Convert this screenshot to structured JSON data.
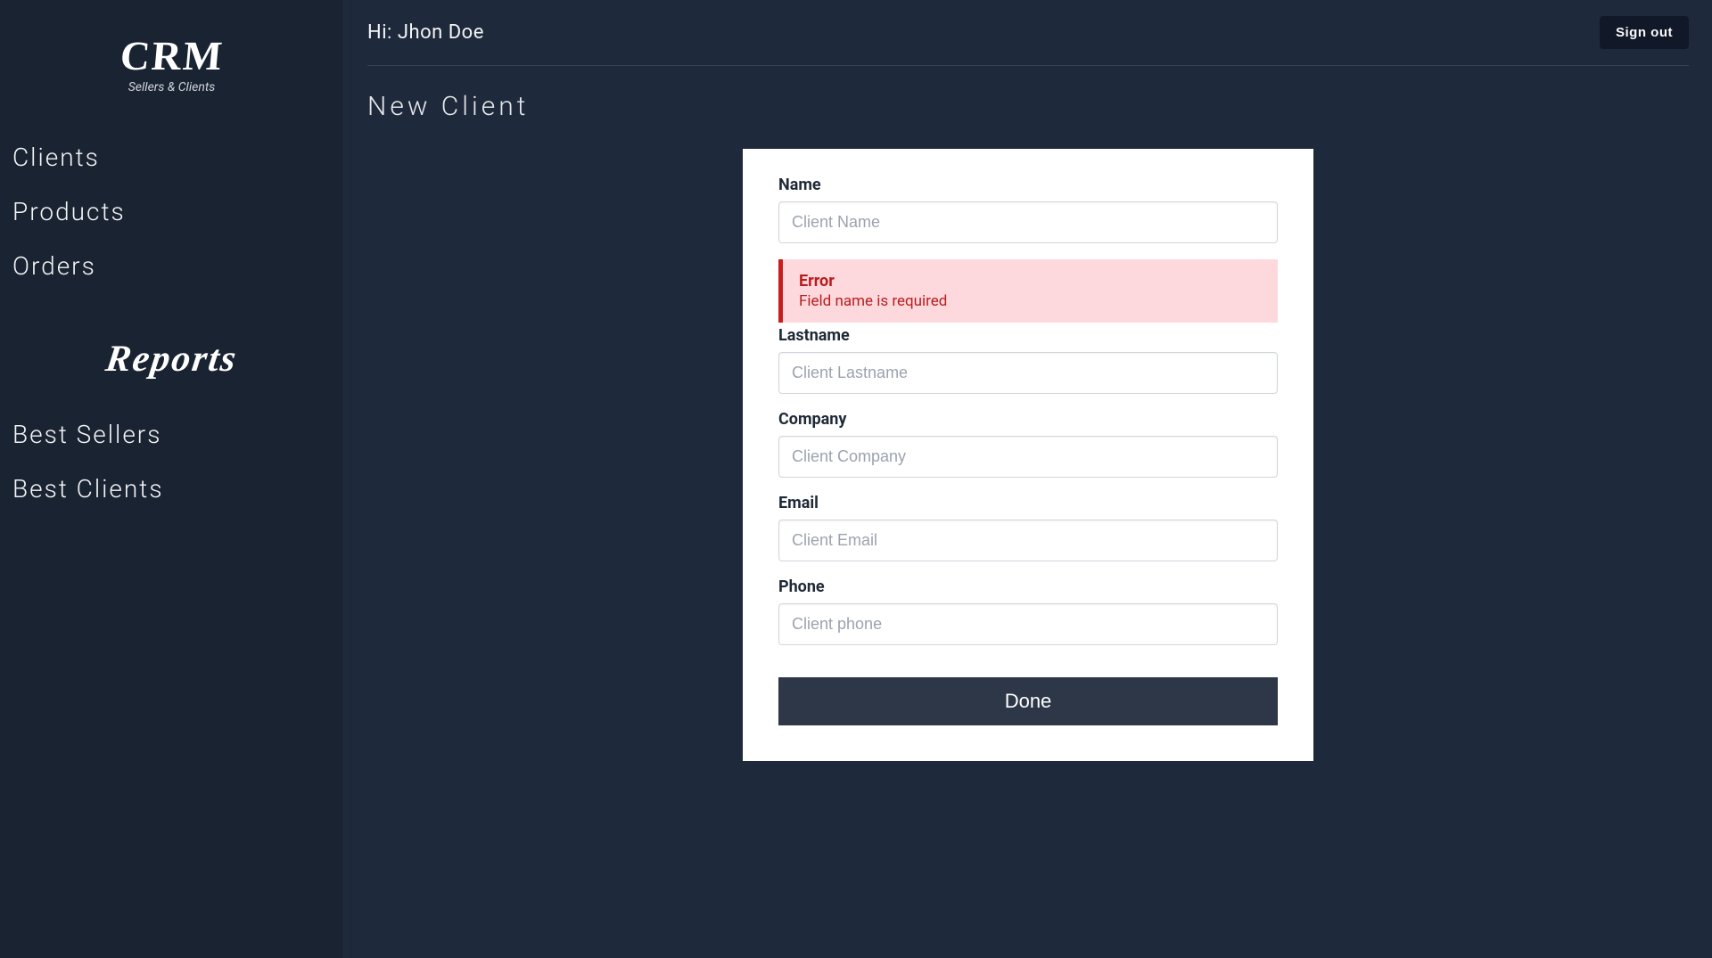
{
  "sidebar": {
    "logo_title": "CRM",
    "logo_sub": "Sellers & Clients",
    "nav": [
      {
        "label": "Clients"
      },
      {
        "label": "Products"
      },
      {
        "label": "Orders"
      }
    ],
    "reports_header": "Reports",
    "reports_nav": [
      {
        "label": "Best Sellers"
      },
      {
        "label": "Best Clients"
      }
    ]
  },
  "header": {
    "greeting": "Hi: Jhon Doe",
    "signout_label": "Sign out"
  },
  "page": {
    "title": "New Client"
  },
  "form": {
    "name": {
      "label": "Name",
      "placeholder": "Client Name",
      "value": ""
    },
    "error": {
      "title": "Error",
      "message": "Field name is required"
    },
    "lastname": {
      "label": "Lastname",
      "placeholder": "Client Lastname",
      "value": ""
    },
    "company": {
      "label": "Company",
      "placeholder": "Client Company",
      "value": ""
    },
    "email": {
      "label": "Email",
      "placeholder": "Client Email",
      "value": ""
    },
    "phone": {
      "label": "Phone",
      "placeholder": "Client phone",
      "value": ""
    },
    "submit_label": "Done"
  }
}
